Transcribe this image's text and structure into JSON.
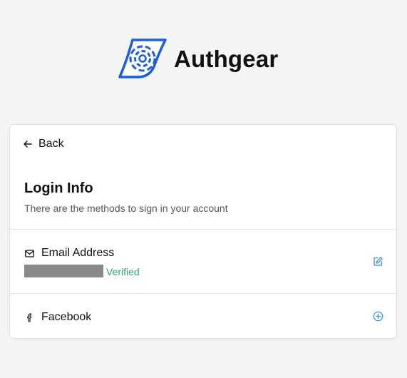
{
  "brand": {
    "name": "Authgear",
    "logo_icon": "authgear-logo-icon"
  },
  "card": {
    "back_label": "Back",
    "title": "Login Info",
    "subtitle": "There are the methods to sign in your account",
    "methods": [
      {
        "icon": "mail-icon",
        "label": "Email Address",
        "status": "Verified",
        "action_icon": "edit-icon"
      },
      {
        "icon": "facebook-icon",
        "label": "Facebook",
        "action_icon": "add-circle-icon"
      }
    ]
  },
  "colors": {
    "accent": "#1b5fd8",
    "verified": "#2aa86a",
    "action": "#2f8de4"
  }
}
